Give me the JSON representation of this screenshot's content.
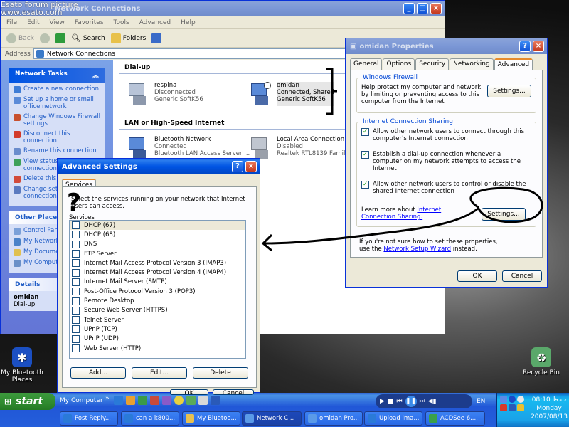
{
  "watermark": {
    "line1": "Esato forum picture",
    "line2": "www.esato.com"
  },
  "desktop_icons": {
    "bluetooth": {
      "label_line1": "My Bluetooth",
      "label_line2": "Places"
    },
    "recycle": {
      "label": "Recycle Bin"
    }
  },
  "netconn": {
    "title": "Network Connections",
    "menu": [
      "File",
      "Edit",
      "View",
      "Favorites",
      "Tools",
      "Advanced",
      "Help"
    ],
    "toolbar": {
      "back": "Back",
      "search": "Search",
      "folders": "Folders"
    },
    "address_label": "Address",
    "address_value": "Network Connections",
    "network_tasks": {
      "title": "Network Tasks",
      "items": [
        "Create a new connection",
        "Set up a home or small office network",
        "Change Windows Firewall settings",
        "Disconnect this connection",
        "Rename this connection",
        "View status of this connection",
        "Delete this connection",
        "Change settings of this connection"
      ]
    },
    "other_places": {
      "title": "Other Places",
      "items": [
        "Control Panel",
        "My Network Places",
        "My Documents",
        "My Computer"
      ]
    },
    "details": {
      "title": "Details",
      "name": "omidan",
      "type": "Dial-up"
    },
    "groups": {
      "dialup": "Dial-up",
      "lan": "LAN or High-Speed Internet"
    },
    "connections": [
      {
        "name": "respina",
        "status": "Disconnected",
        "device": "Generic SoftK56"
      },
      {
        "name": "omidan",
        "status": "Connected, Shared",
        "device": "Generic SoftK56"
      },
      {
        "name": "Bluetooth Network",
        "status": "Connected",
        "device": "Bluetooth LAN Access Server ..."
      },
      {
        "name": "Local Area Connection",
        "status": "Disabled",
        "device": "Realtek RTL8139 Family P..."
      }
    ]
  },
  "props": {
    "title": "omidan Properties",
    "tabs": [
      "General",
      "Options",
      "Security",
      "Networking",
      "Advanced"
    ],
    "firewall": {
      "legend": "Windows Firewall",
      "text": "Help protect my computer and network by limiting or preventing access to this computer from the Internet",
      "button": "Settings..."
    },
    "ics": {
      "legend": "Internet Connection Sharing",
      "checks": [
        "Allow other network users to connect through this computer's Internet connection",
        "Establish a dial-up connection whenever a computer on my network attempts to access the Internet",
        "Allow other network users to control or disable the shared Internet connection"
      ],
      "learn_prefix": "Learn more about",
      "learn_link": "Internet Connection Sharing.",
      "button": "Settings..."
    },
    "wizard_prefix": "If you're not sure how to set these properties, use the",
    "wizard_link": "Network Setup Wizard",
    "wizard_suffix": "instead.",
    "ok": "OK",
    "cancel": "Cancel"
  },
  "adv": {
    "title": "Advanced Settings",
    "tab": "Services",
    "desc": "Select the services running on your network that Internet users can access.",
    "list_label": "Services",
    "services": [
      "DHCP (67)",
      "DHCP (68)",
      "DNS",
      "FTP Server",
      "Internet Mail Access Protocol Version 3 (IMAP3)",
      "Internet Mail Access Protocol Version 4 (IMAP4)",
      "Internet Mail Server (SMTP)",
      "Post-Office Protocol Version 3 (POP3)",
      "Remote Desktop",
      "Secure Web Server (HTTPS)",
      "Telnet Server",
      "UPnP (TCP)",
      "UPnP (UDP)",
      "Web Server (HTTP)"
    ],
    "add": "Add...",
    "edit": "Edit...",
    "delete": "Delete",
    "ok": "OK",
    "cancel": "Cancel",
    "annotation": "?"
  },
  "taskbar": {
    "start": "start",
    "my_computer": "My Computer",
    "lang": "EN",
    "buttons": [
      "Post Reply...",
      "can a k800...",
      "My Bluetoo...",
      "Network C...",
      "omidan Pro...",
      "Upload ima...",
      "ACDSee 6...."
    ],
    "time": "08:10 ب.ظ",
    "day": "Monday",
    "date": "2007/08/13"
  },
  "colors": {
    "xp_blue": "#0054e3",
    "start_green": "#2f8a2f",
    "link_blue": "#215dc6"
  }
}
